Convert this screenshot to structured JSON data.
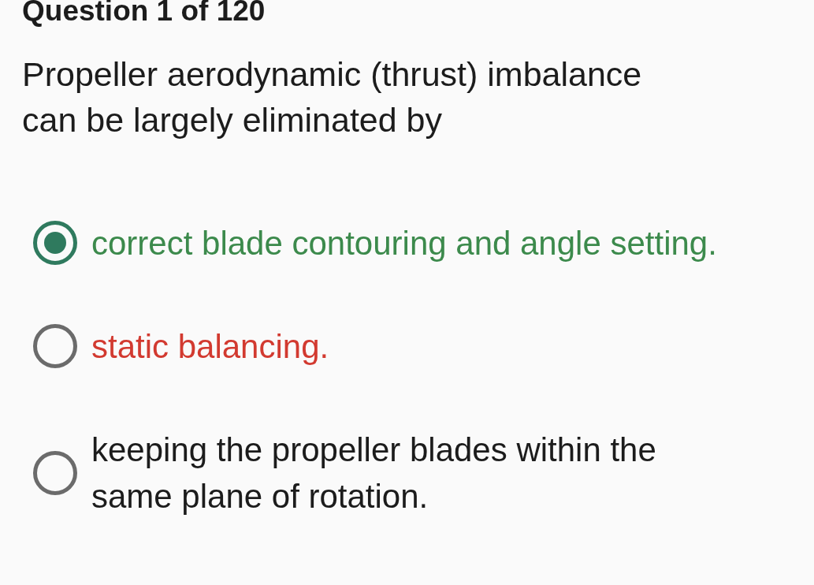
{
  "header": {
    "title": "Question 1 of 120"
  },
  "question": {
    "text": "Propeller aerodynamic (thrust) imbalance can be largely eliminated by"
  },
  "options": [
    {
      "label": "correct blade contouring and angle setting.",
      "selected": true,
      "color": "#3c8a4c"
    },
    {
      "label": "static balancing.",
      "selected": false,
      "color": "#d23a30"
    },
    {
      "label": "keeping the propeller blades within the same plane of rotation.",
      "selected": false,
      "color": "#1c1c1c"
    }
  ]
}
